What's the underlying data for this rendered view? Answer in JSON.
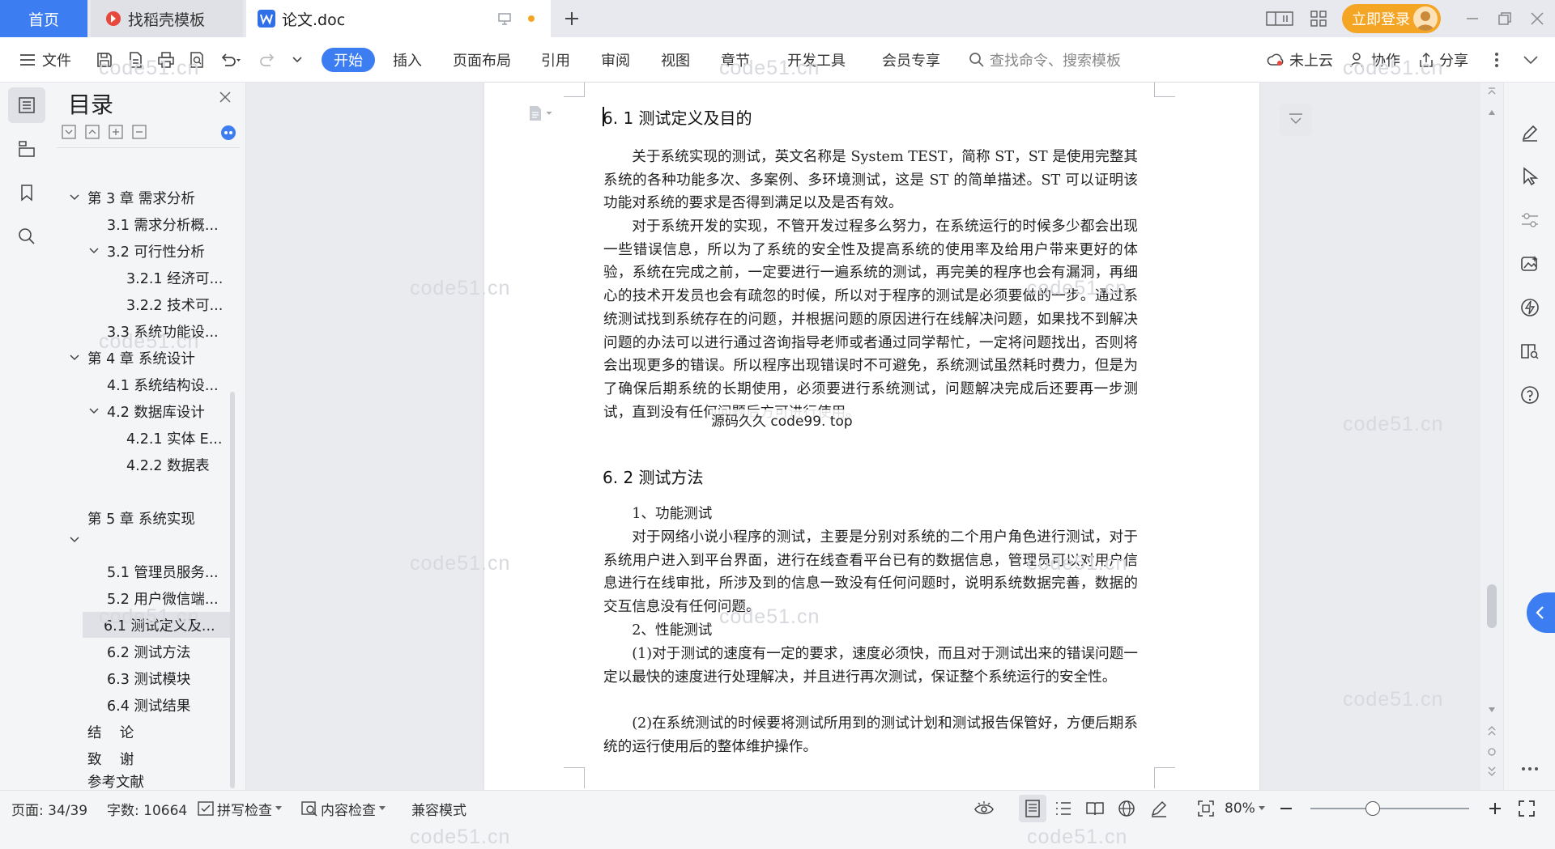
{
  "tabs": {
    "home": "首页",
    "docer": "找稻壳模板",
    "document": "论文.doc"
  },
  "titlebar": {
    "login": "立即登录"
  },
  "toolbar": {
    "file": "文件",
    "ribbon_tabs": [
      "开始",
      "插入",
      "页面布局",
      "引用",
      "审阅",
      "视图",
      "章节",
      "开发工具",
      "会员专享"
    ],
    "search_placeholder": "查找命令、搜索模板",
    "cloud": "未上云",
    "collab": "协作",
    "share": "分享"
  },
  "toc": {
    "title": "目录",
    "items": [
      "第 3 章  需求分析",
      "3.1 需求分析概...",
      "3.2 可行性分析",
      "3.2.1 经济可...",
      "3.2.2 技术可...",
      "3.3 系统功能设...",
      "第 4 章  系统设计",
      "4.1 系统结构设...",
      "4.2 数据库设计",
      "4.2.1 实体 E...",
      "4.2.2 数据表",
      "第 5 章  系统实现",
      "5.1 管理员服务...",
      "5.2 用户微信端...",
      "6.1 测试定义及...",
      "6.2 测试方法",
      "6.3 测试模块",
      "6.4 测试结果",
      "结    论",
      "致    谢",
      "参考文献"
    ]
  },
  "document": {
    "heading1": "6. 1 测试定义及目的",
    "para1": "关于系统实现的测试，英文名称是 System TEST，简称 ST，ST 是使用完整其系统的各种功能多次、多案例、多环境测试，这是 ST 的简单描述。ST 可以证明该功能对系统的要求是否得到满足以及是否有效。",
    "para2": "对于系统开发的实现，不管开发过程多么努力，在系统运行的时候多少都会出现一些错误信息，所以为了系统的安全性及提高系统的使用率及给用户带来更好的体验，系统在完成之前，一定要进行一遍系统的测试，再完美的程序也会有漏洞，再细心的技术开发员也会有疏忽的时候，所以对于程序的测试是必须要做的一步。通过系统测试找到系统存在的问题，并根据问题的原因进行在线解决问题，如果找不到解决问题的办法可以进行通过咨询指导老师或者通过同学帮忙，一定将问题找出，否则将会出现更多的错误。所以程序出现错误时不可避免，系统测试虽然耗时费力，但是为了确保后期系统的长期使用，必须要进行系统测试，问题解决完成后还要再一步测试，直到没有任何问题后方可进行使用。",
    "heading2": "6. 2 测试方法",
    "sub1": "1、功能测试",
    "para3": "对于网络小说小程序的测试，主要是分别对系统的二个用户角色进行测试，对于系统用户进入到平台界面，进行在线查看平台已有的数据信息，管理员可以对用户信息进行在线审批，所涉及到的信息一致没有任何问题时，说明系统数据完善，数据的交互信息没有任何问题。",
    "sub2": "2、性能测试",
    "para4": "(1)对于测试的速度有一定的要求，速度必须快，而且对于测试出来的错误问题一定以最快的速度进行处理解决，并且进行再次测试，保证整个系统运行的安全性。",
    "para5": "(2)在系统测试的时候要将测试所用到的测试计划和测试报告保管好，方便后期系统的运行使用后的整体维护操作。",
    "stamp": "源码久久  code99. top",
    "watermark": "code51.cn"
  },
  "status": {
    "page": "页面: 34/39",
    "words": "字数: 10664",
    "spell": "拼写检查",
    "content_check": "内容检查",
    "compat": "兼容模式",
    "zoom": "80%"
  },
  "colors": {
    "accent": "#3d7df2",
    "login": "#f5a524"
  }
}
